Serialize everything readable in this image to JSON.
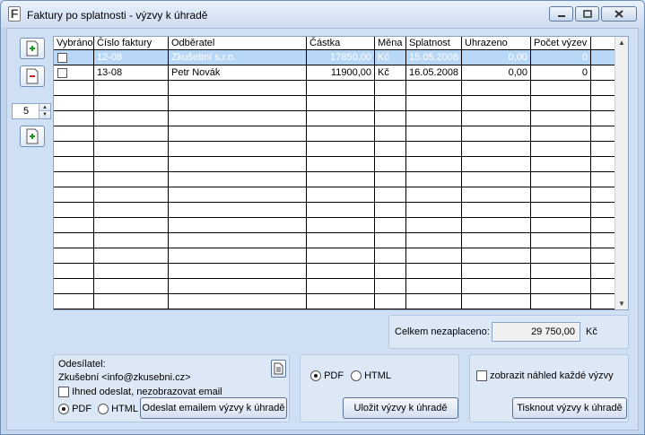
{
  "window": {
    "title": "Faktury po splatnosti - výzvy k úhradě",
    "app_letter": "F"
  },
  "sidebar": {
    "spin_value": "5"
  },
  "grid": {
    "columns": [
      "Vybráno",
      "Číslo faktury",
      "Odběratel",
      "Částka",
      "Měna",
      "Splatnost",
      "Uhrazeno",
      "Počet výzev"
    ],
    "rows": [
      {
        "checked": false,
        "selected": true,
        "number": "12-08",
        "customer": "Zkušební s.r.o.",
        "amount": "17850,00",
        "currency": "Kč",
        "due": "15.05.2008",
        "paid": "0,00",
        "reminders": "0"
      },
      {
        "checked": false,
        "selected": false,
        "number": "13-08",
        "customer": "Petr Novák",
        "amount": "11900,00",
        "currency": "Kč",
        "due": "16.05.2008",
        "paid": "0,00",
        "reminders": "0"
      }
    ]
  },
  "total": {
    "label": "Celkem nezaplaceno:",
    "value": "29 750,00",
    "currency": "Kč"
  },
  "email_group": {
    "sender_label": "Odesílatel:",
    "sender": "Zkušební <info@zkusebni.cz>",
    "send_now_label": "Ihned odeslat, nezobrazovat email",
    "pdf_label": "PDF",
    "html_label": "HTML",
    "format_selected": "PDF",
    "send_button": "Odeslat emailem výzvy k úhradě"
  },
  "save_group": {
    "pdf_label": "PDF",
    "html_label": "HTML",
    "format_selected": "PDF",
    "save_button": "Uložit výzvy k úhradě"
  },
  "print_group": {
    "preview_label": "zobrazit náhled každé výzvy",
    "print_button": "Tisknout výzvy k úhradě"
  }
}
